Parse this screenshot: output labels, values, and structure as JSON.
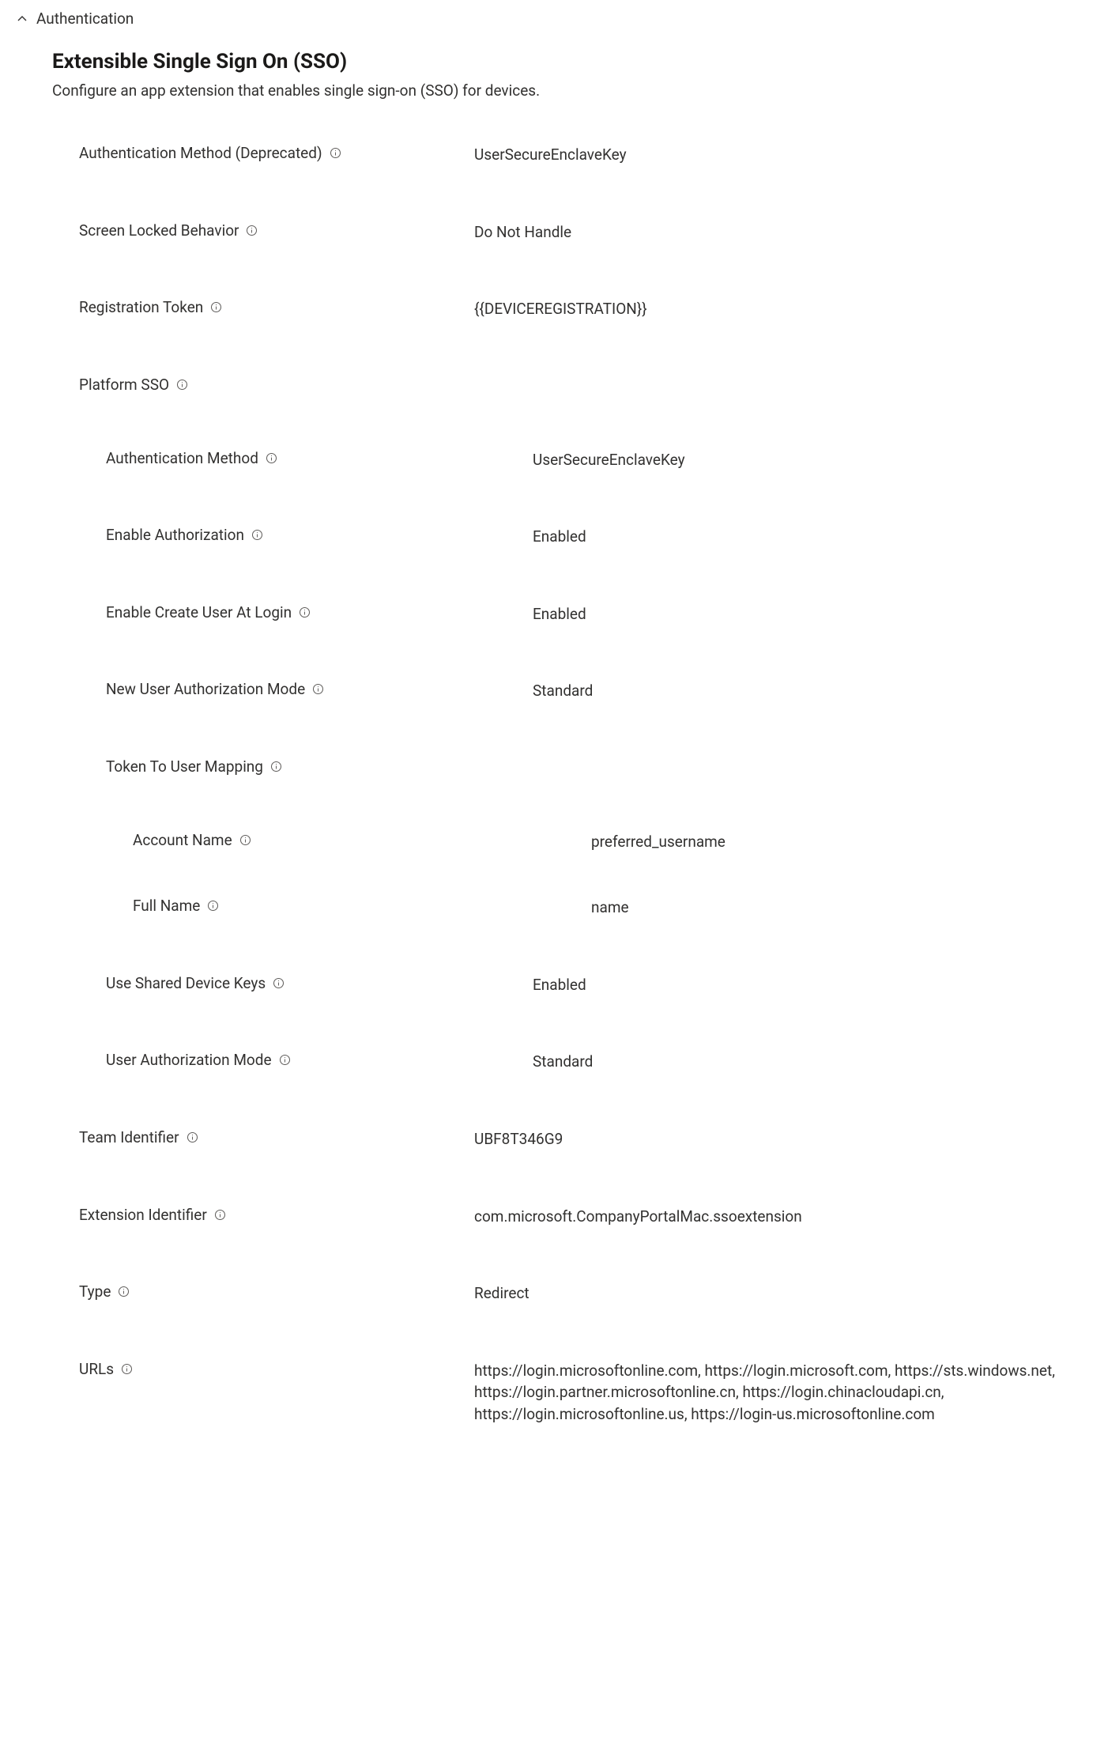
{
  "section": {
    "header": "Authentication",
    "title": "Extensible Single Sign On (SSO)",
    "description": "Configure an app extension that enables single sign-on (SSO) for devices."
  },
  "fields": {
    "auth_method_deprecated": {
      "label": "Authentication Method (Deprecated)",
      "value": "UserSecureEnclaveKey"
    },
    "screen_locked_behavior": {
      "label": "Screen Locked Behavior",
      "value": "Do Not Handle"
    },
    "registration_token": {
      "label": "Registration Token",
      "value": "{{DEVICEREGISTRATION}}"
    },
    "platform_sso": {
      "label": "Platform SSO"
    },
    "p_auth_method": {
      "label": "Authentication Method",
      "value": "UserSecureEnclaveKey"
    },
    "p_enable_authorization": {
      "label": "Enable Authorization",
      "value": "Enabled"
    },
    "p_enable_create_user": {
      "label": "Enable Create User At Login",
      "value": "Enabled"
    },
    "p_new_user_auth_mode": {
      "label": "New User Authorization Mode",
      "value": "Standard"
    },
    "p_token_to_user_mapping": {
      "label": "Token To User Mapping"
    },
    "p_account_name": {
      "label": "Account Name",
      "value": "preferred_username"
    },
    "p_full_name": {
      "label": "Full Name",
      "value": "name"
    },
    "p_use_shared_device_keys": {
      "label": "Use Shared Device Keys",
      "value": "Enabled"
    },
    "p_user_authorization_mode": {
      "label": "User Authorization Mode",
      "value": "Standard"
    },
    "team_identifier": {
      "label": "Team Identifier",
      "value": "UBF8T346G9"
    },
    "extension_identifier": {
      "label": "Extension Identifier",
      "value": "com.microsoft.CompanyPortalMac.ssoextension"
    },
    "type": {
      "label": "Type",
      "value": "Redirect"
    },
    "urls": {
      "label": "URLs",
      "value": "https://login.microsoftonline.com, https://login.microsoft.com, https://sts.windows.net, https://login.partner.microsoftonline.cn, https://login.chinacloudapi.cn, https://login.microsoftonline.us, https://login-us.microsoftonline.com"
    }
  }
}
